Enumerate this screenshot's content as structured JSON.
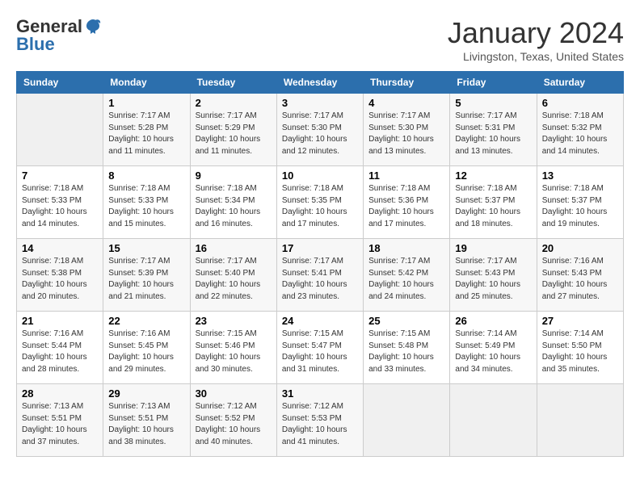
{
  "header": {
    "logo_general": "General",
    "logo_blue": "Blue",
    "month_title": "January 2024",
    "location": "Livingston, Texas, United States"
  },
  "days_of_week": [
    "Sunday",
    "Monday",
    "Tuesday",
    "Wednesday",
    "Thursday",
    "Friday",
    "Saturday"
  ],
  "weeks": [
    [
      {
        "day": "",
        "sunrise": "",
        "sunset": "",
        "daylight": ""
      },
      {
        "day": "1",
        "sunrise": "Sunrise: 7:17 AM",
        "sunset": "Sunset: 5:28 PM",
        "daylight": "Daylight: 10 hours and 11 minutes."
      },
      {
        "day": "2",
        "sunrise": "Sunrise: 7:17 AM",
        "sunset": "Sunset: 5:29 PM",
        "daylight": "Daylight: 10 hours and 11 minutes."
      },
      {
        "day": "3",
        "sunrise": "Sunrise: 7:17 AM",
        "sunset": "Sunset: 5:30 PM",
        "daylight": "Daylight: 10 hours and 12 minutes."
      },
      {
        "day": "4",
        "sunrise": "Sunrise: 7:17 AM",
        "sunset": "Sunset: 5:30 PM",
        "daylight": "Daylight: 10 hours and 13 minutes."
      },
      {
        "day": "5",
        "sunrise": "Sunrise: 7:17 AM",
        "sunset": "Sunset: 5:31 PM",
        "daylight": "Daylight: 10 hours and 13 minutes."
      },
      {
        "day": "6",
        "sunrise": "Sunrise: 7:18 AM",
        "sunset": "Sunset: 5:32 PM",
        "daylight": "Daylight: 10 hours and 14 minutes."
      }
    ],
    [
      {
        "day": "7",
        "sunrise": "Sunrise: 7:18 AM",
        "sunset": "Sunset: 5:33 PM",
        "daylight": "Daylight: 10 hours and 14 minutes."
      },
      {
        "day": "8",
        "sunrise": "Sunrise: 7:18 AM",
        "sunset": "Sunset: 5:33 PM",
        "daylight": "Daylight: 10 hours and 15 minutes."
      },
      {
        "day": "9",
        "sunrise": "Sunrise: 7:18 AM",
        "sunset": "Sunset: 5:34 PM",
        "daylight": "Daylight: 10 hours and 16 minutes."
      },
      {
        "day": "10",
        "sunrise": "Sunrise: 7:18 AM",
        "sunset": "Sunset: 5:35 PM",
        "daylight": "Daylight: 10 hours and 17 minutes."
      },
      {
        "day": "11",
        "sunrise": "Sunrise: 7:18 AM",
        "sunset": "Sunset: 5:36 PM",
        "daylight": "Daylight: 10 hours and 17 minutes."
      },
      {
        "day": "12",
        "sunrise": "Sunrise: 7:18 AM",
        "sunset": "Sunset: 5:37 PM",
        "daylight": "Daylight: 10 hours and 18 minutes."
      },
      {
        "day": "13",
        "sunrise": "Sunrise: 7:18 AM",
        "sunset": "Sunset: 5:37 PM",
        "daylight": "Daylight: 10 hours and 19 minutes."
      }
    ],
    [
      {
        "day": "14",
        "sunrise": "Sunrise: 7:18 AM",
        "sunset": "Sunset: 5:38 PM",
        "daylight": "Daylight: 10 hours and 20 minutes."
      },
      {
        "day": "15",
        "sunrise": "Sunrise: 7:17 AM",
        "sunset": "Sunset: 5:39 PM",
        "daylight": "Daylight: 10 hours and 21 minutes."
      },
      {
        "day": "16",
        "sunrise": "Sunrise: 7:17 AM",
        "sunset": "Sunset: 5:40 PM",
        "daylight": "Daylight: 10 hours and 22 minutes."
      },
      {
        "day": "17",
        "sunrise": "Sunrise: 7:17 AM",
        "sunset": "Sunset: 5:41 PM",
        "daylight": "Daylight: 10 hours and 23 minutes."
      },
      {
        "day": "18",
        "sunrise": "Sunrise: 7:17 AM",
        "sunset": "Sunset: 5:42 PM",
        "daylight": "Daylight: 10 hours and 24 minutes."
      },
      {
        "day": "19",
        "sunrise": "Sunrise: 7:17 AM",
        "sunset": "Sunset: 5:43 PM",
        "daylight": "Daylight: 10 hours and 25 minutes."
      },
      {
        "day": "20",
        "sunrise": "Sunrise: 7:16 AM",
        "sunset": "Sunset: 5:43 PM",
        "daylight": "Daylight: 10 hours and 27 minutes."
      }
    ],
    [
      {
        "day": "21",
        "sunrise": "Sunrise: 7:16 AM",
        "sunset": "Sunset: 5:44 PM",
        "daylight": "Daylight: 10 hours and 28 minutes."
      },
      {
        "day": "22",
        "sunrise": "Sunrise: 7:16 AM",
        "sunset": "Sunset: 5:45 PM",
        "daylight": "Daylight: 10 hours and 29 minutes."
      },
      {
        "day": "23",
        "sunrise": "Sunrise: 7:15 AM",
        "sunset": "Sunset: 5:46 PM",
        "daylight": "Daylight: 10 hours and 30 minutes."
      },
      {
        "day": "24",
        "sunrise": "Sunrise: 7:15 AM",
        "sunset": "Sunset: 5:47 PM",
        "daylight": "Daylight: 10 hours and 31 minutes."
      },
      {
        "day": "25",
        "sunrise": "Sunrise: 7:15 AM",
        "sunset": "Sunset: 5:48 PM",
        "daylight": "Daylight: 10 hours and 33 minutes."
      },
      {
        "day": "26",
        "sunrise": "Sunrise: 7:14 AM",
        "sunset": "Sunset: 5:49 PM",
        "daylight": "Daylight: 10 hours and 34 minutes."
      },
      {
        "day": "27",
        "sunrise": "Sunrise: 7:14 AM",
        "sunset": "Sunset: 5:50 PM",
        "daylight": "Daylight: 10 hours and 35 minutes."
      }
    ],
    [
      {
        "day": "28",
        "sunrise": "Sunrise: 7:13 AM",
        "sunset": "Sunset: 5:51 PM",
        "daylight": "Daylight: 10 hours and 37 minutes."
      },
      {
        "day": "29",
        "sunrise": "Sunrise: 7:13 AM",
        "sunset": "Sunset: 5:51 PM",
        "daylight": "Daylight: 10 hours and 38 minutes."
      },
      {
        "day": "30",
        "sunrise": "Sunrise: 7:12 AM",
        "sunset": "Sunset: 5:52 PM",
        "daylight": "Daylight: 10 hours and 40 minutes."
      },
      {
        "day": "31",
        "sunrise": "Sunrise: 7:12 AM",
        "sunset": "Sunset: 5:53 PM",
        "daylight": "Daylight: 10 hours and 41 minutes."
      },
      {
        "day": "",
        "sunrise": "",
        "sunset": "",
        "daylight": ""
      },
      {
        "day": "",
        "sunrise": "",
        "sunset": "",
        "daylight": ""
      },
      {
        "day": "",
        "sunrise": "",
        "sunset": "",
        "daylight": ""
      }
    ]
  ]
}
